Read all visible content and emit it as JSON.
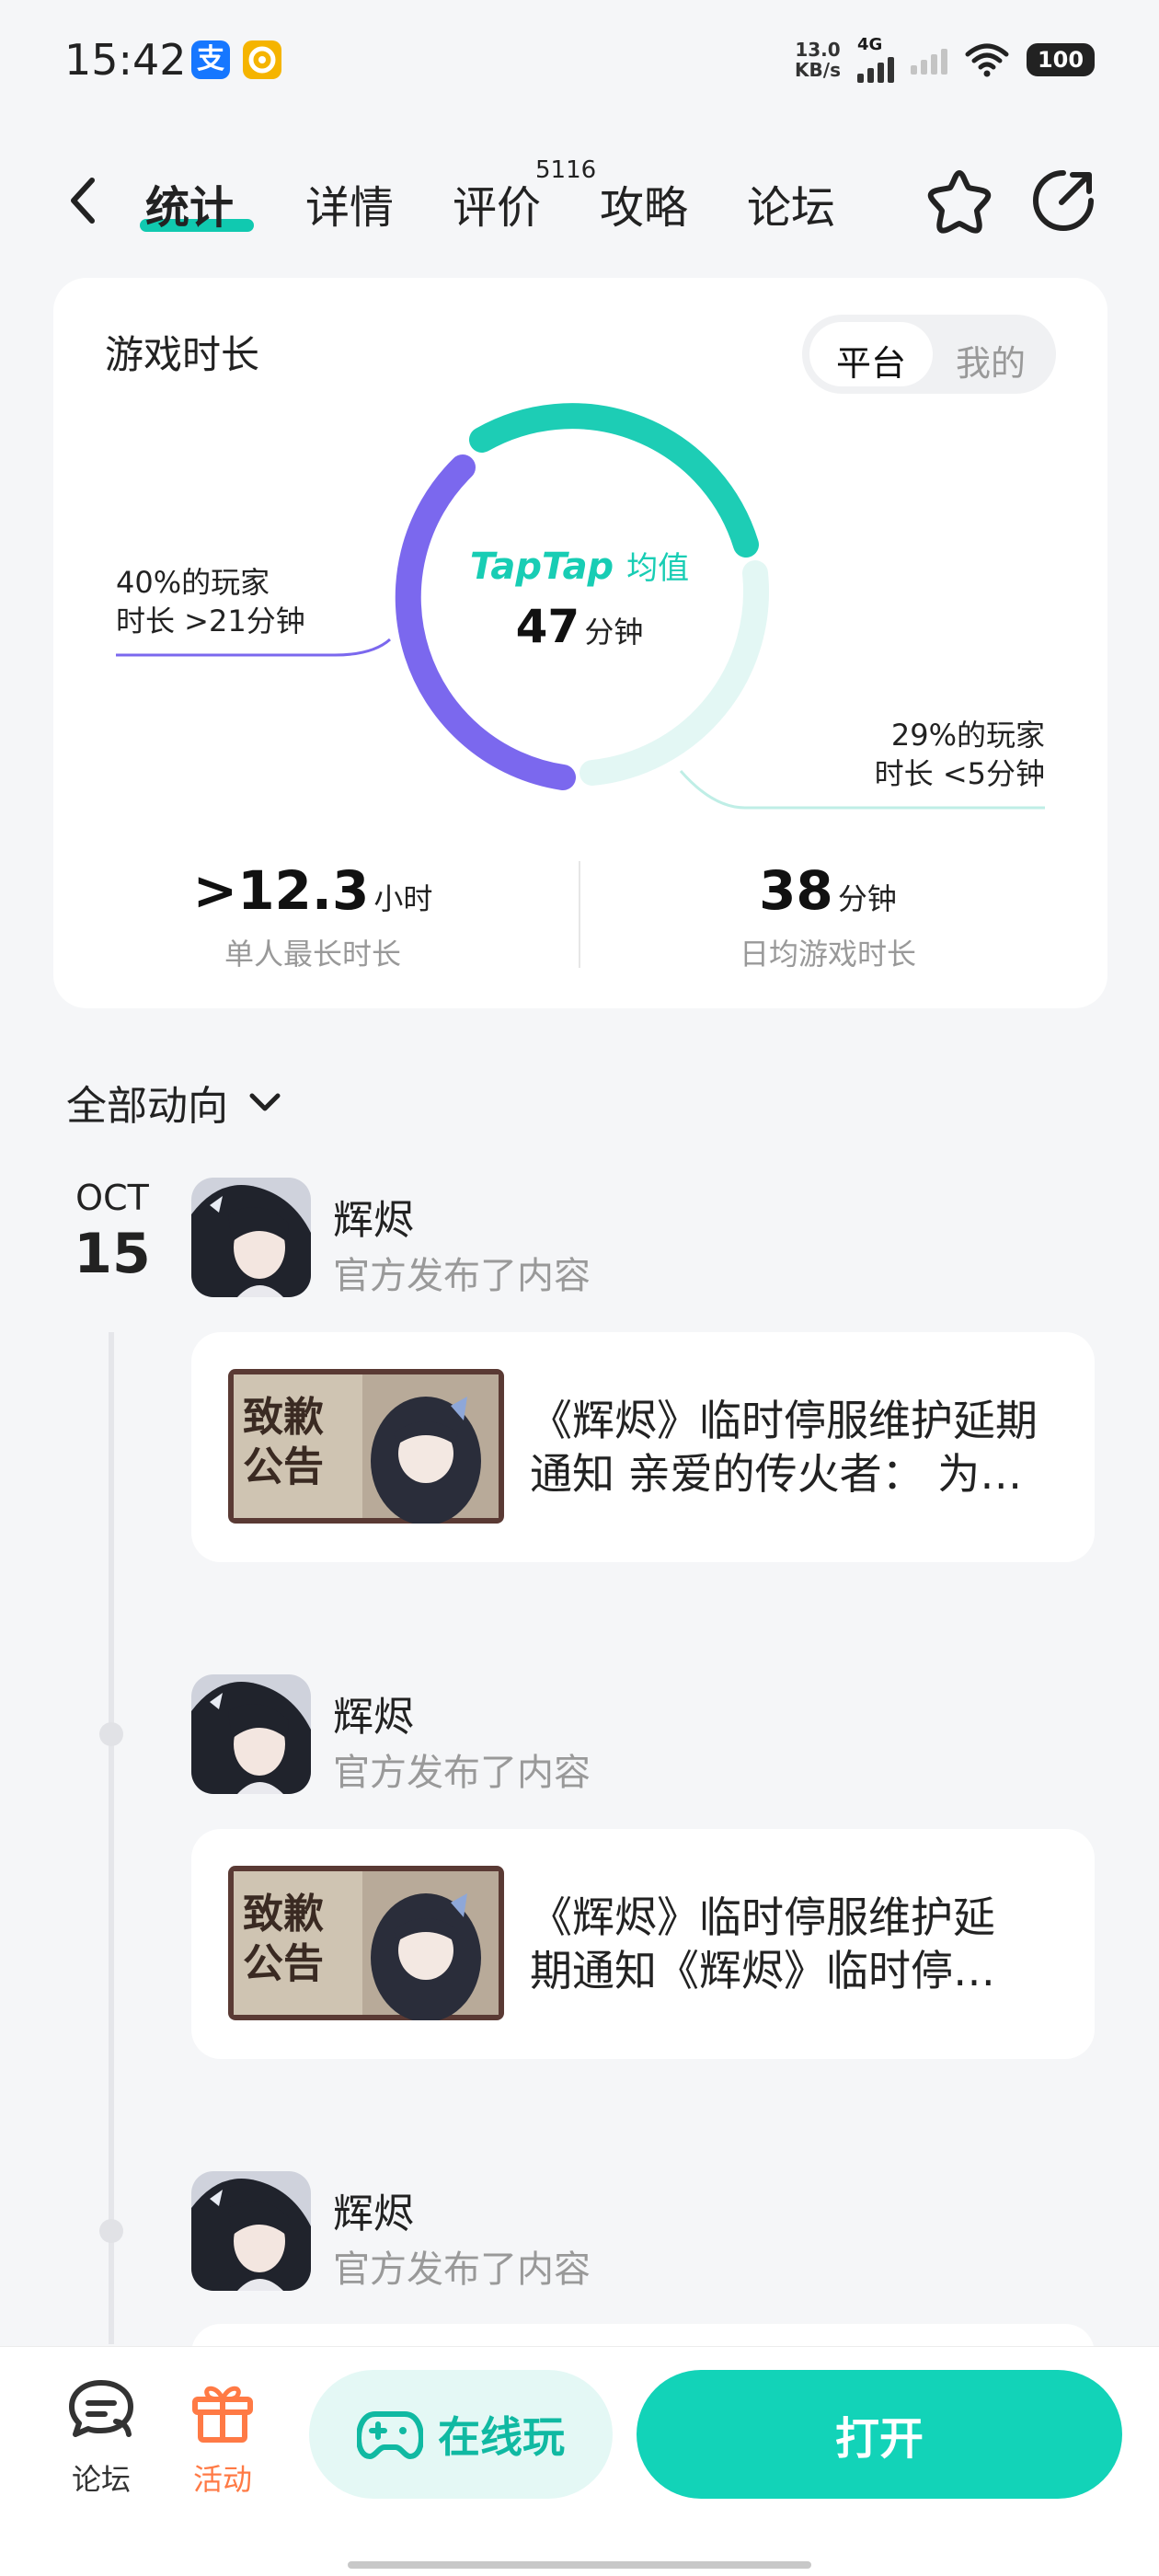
{
  "status": {
    "time": "15:42",
    "netspeed_value": "13.0",
    "netspeed_unit": "KB/s",
    "network": "4G",
    "battery": "100"
  },
  "nav": {
    "tabs": [
      "统计",
      "详情",
      "评价",
      "攻略",
      "论坛"
    ],
    "review_count": "5116"
  },
  "stats_card": {
    "title": "游戏时长",
    "toggle": [
      "平台",
      "我的"
    ],
    "left_annotation": [
      "40%的玩家",
      "时长 >21分钟"
    ],
    "right_annotation": [
      "29%的玩家",
      "时长 <5分钟"
    ],
    "brand": "TapTap",
    "brand_suffix": "均值",
    "average_value": "47",
    "average_unit": "分钟",
    "stat1_value": ">12.3",
    "stat1_unit": "小时",
    "stat1_label": "单人最长时长",
    "stat2_value": "38",
    "stat2_unit": "分钟",
    "stat2_label": "日均游戏时长",
    "colors": {
      "purple": "#7b68ee",
      "teal": "#1dcdb5",
      "pale": "#e3f7f4"
    }
  },
  "feed": {
    "filter_label": "全部动向",
    "date_month": "OCT",
    "date_day": "15",
    "posts": [
      {
        "author": "辉烬",
        "subtitle": "官方发布了内容",
        "text_line1": "《辉烬》临时停服维护延期",
        "text_line2": "通知 亲爱的传火者： 为…",
        "thumb_text": [
          "致歉",
          "公告"
        ]
      },
      {
        "author": "辉烬",
        "subtitle": "官方发布了内容",
        "text_line1": "《辉烬》临时停服维护延",
        "text_line2": "期通知《辉烬》临时停…",
        "thumb_text": [
          "致歉",
          "公告"
        ]
      },
      {
        "author": "辉烬",
        "subtitle": "官方发布了内容"
      }
    ]
  },
  "bottom": {
    "forum_label": "论坛",
    "activity_label": "活动",
    "online_label": "在线玩",
    "open_label": "打开"
  }
}
